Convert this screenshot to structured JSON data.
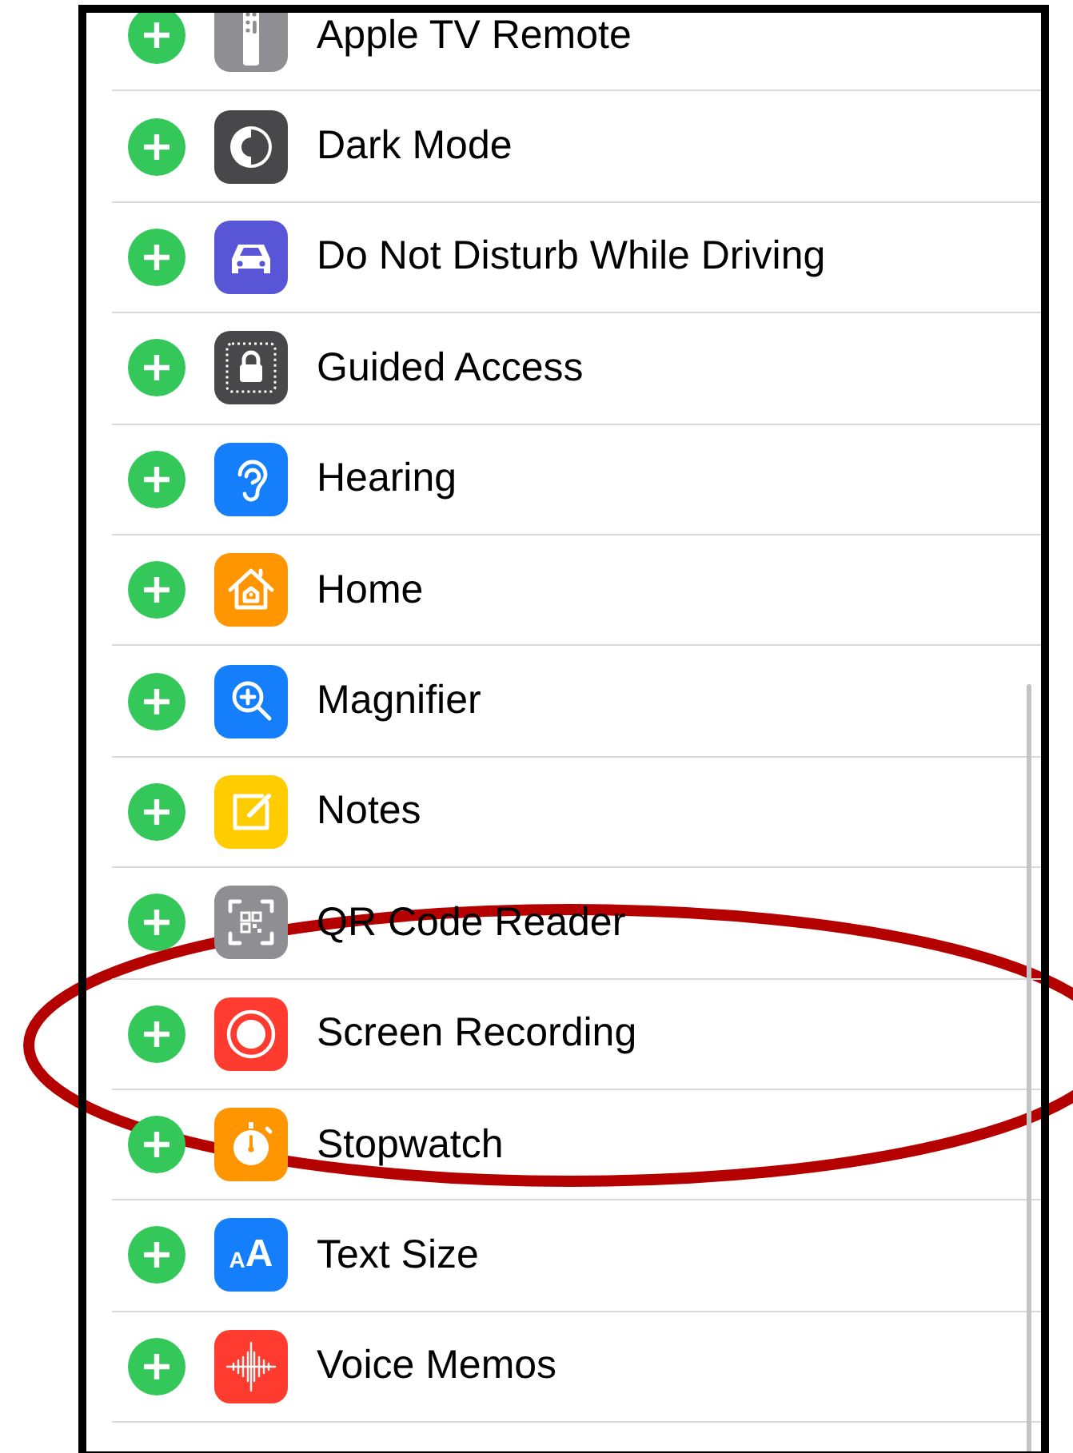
{
  "items": [
    {
      "label": "Apple TV Remote",
      "icon": {
        "kind": "remote",
        "color": "#8e8e93"
      }
    },
    {
      "label": "Dark Mode",
      "icon": {
        "kind": "dark-mode",
        "color": "#48484a"
      }
    },
    {
      "label": "Do Not Disturb While Driving",
      "icon": {
        "kind": "car",
        "color": "#5856d6"
      }
    },
    {
      "label": "Guided Access",
      "icon": {
        "kind": "lock",
        "color": "#48484a"
      }
    },
    {
      "label": "Hearing",
      "icon": {
        "kind": "ear",
        "color": "#147efb"
      }
    },
    {
      "label": "Home",
      "icon": {
        "kind": "house",
        "color": "#ff9500"
      }
    },
    {
      "label": "Magnifier",
      "icon": {
        "kind": "magnifier",
        "color": "#147efb"
      }
    },
    {
      "label": "Notes",
      "icon": {
        "kind": "notes",
        "color": "#ffcc00"
      }
    },
    {
      "label": "QR Code Reader",
      "icon": {
        "kind": "qr",
        "color": "#8e8e93"
      }
    },
    {
      "label": "Screen Recording",
      "icon": {
        "kind": "record",
        "color": "#ff3b30"
      }
    },
    {
      "label": "Stopwatch",
      "icon": {
        "kind": "stopwatch",
        "color": "#ff9500"
      }
    },
    {
      "label": "Text Size",
      "icon": {
        "kind": "text-size",
        "color": "#147efb",
        "glyphs": [
          "A",
          "A"
        ]
      }
    },
    {
      "label": "Voice Memos",
      "icon": {
        "kind": "waveform",
        "color": "#ff3b30"
      }
    }
  ],
  "annotation": {
    "kind": "ellipse"
  }
}
